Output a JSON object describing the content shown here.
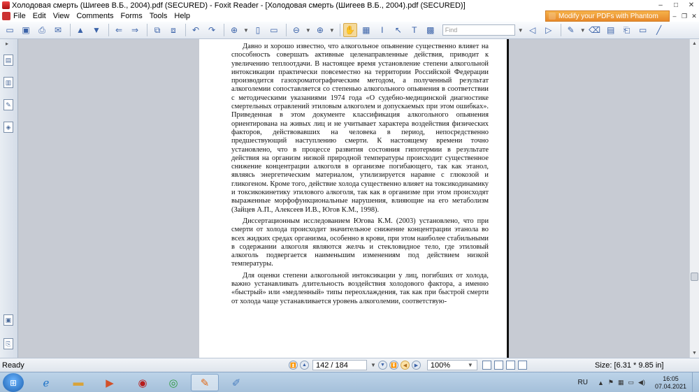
{
  "window": {
    "title": "Холодовая смерть (Шигеев В.Б., 2004).pdf (SECURED) - Foxit Reader - [Холодовая смерть (Шигеев В.Б., 2004).pdf (SECURED)]",
    "minimize": "–",
    "maximize": "□",
    "close": "✕"
  },
  "menu": {
    "items": [
      "File",
      "Edit",
      "View",
      "Comments",
      "Forms",
      "Tools",
      "Help"
    ],
    "promo": "Modify your PDFs with Phantom"
  },
  "toolbar": {
    "find_placeholder": "Find"
  },
  "document": {
    "paragraphs": [
      "Давно и хорошо известно, что алкогольное опьянение существенно влияет на способность совершать активные целенаправленные действия, приводит к увеличению теплоотдачи. В настоящее время установление степени алкогольной интоксикации практически повсеместно на территории Российской Федерации производится газохроматографическим методом, а полученный результат алкоголемии сопоставляется со степенью алкогольного опьянения в соответствии с методическими указаниями 1974 года «О судебно-медицинской диагностике смертельных отравлений этиловым алкоголем и допускаемых при этом ошибках». Приведенная в этом документе классификация алкогольного опьянения ориентирована на живых лиц и не учитывает характера воздействия физических факторов, действовавших на человека в период, непосредственно предшествующий наступлению смерти. К настоящему времени точно установлено, что в процессе развития состояния гипотермии в результате действия на организм низкой природной температуры происходит существенное снижение концентрации алкоголя в организме погибающего, так как этанол, являясь энергетическим материалом, утилизируется наравне с глюкозой и гликогеном. Кроме того, действие холода существенно влияет на токсикодинамику и токсикокинетику этилового алкоголя, так как в организме при этом происходят выраженные морфофункциональные нарушения, влияющие на его метаболизм (Зайцев А.П., Алексеев И.В., Югов К.М., 1998).",
      "Диссертационным исследованием Юговa К.М. (2003) установлено, что при смерти от холода происходит значительное снижение концентрации этанола во всех жидких средах организма, особенно в крови, при этом наиболее стабильными в содержании алкоголя являются желчь и стекловидное тело, где этиловый алкоголь подвергается наименьшим изменениям под действием низкой температуры.",
      "Для оценки степени алкогольной интоксикации у лиц, погибших от холода, важно устанавливать длительность воздействия холодового фактора, а именно «быстрый» или «медленный» типы переохлаждения, так как при быстрой смерти от холода чаще устанавливается уровень алкоголемии, соответствую-"
    ]
  },
  "statusbar": {
    "status": "Ready",
    "page_indicator": "142 / 184",
    "zoom": "100%",
    "page_size": "Size: [6.31 * 9.85 in]"
  },
  "taskbar": {
    "language": "RU",
    "time": "16:05",
    "date": "07.04.2021"
  }
}
